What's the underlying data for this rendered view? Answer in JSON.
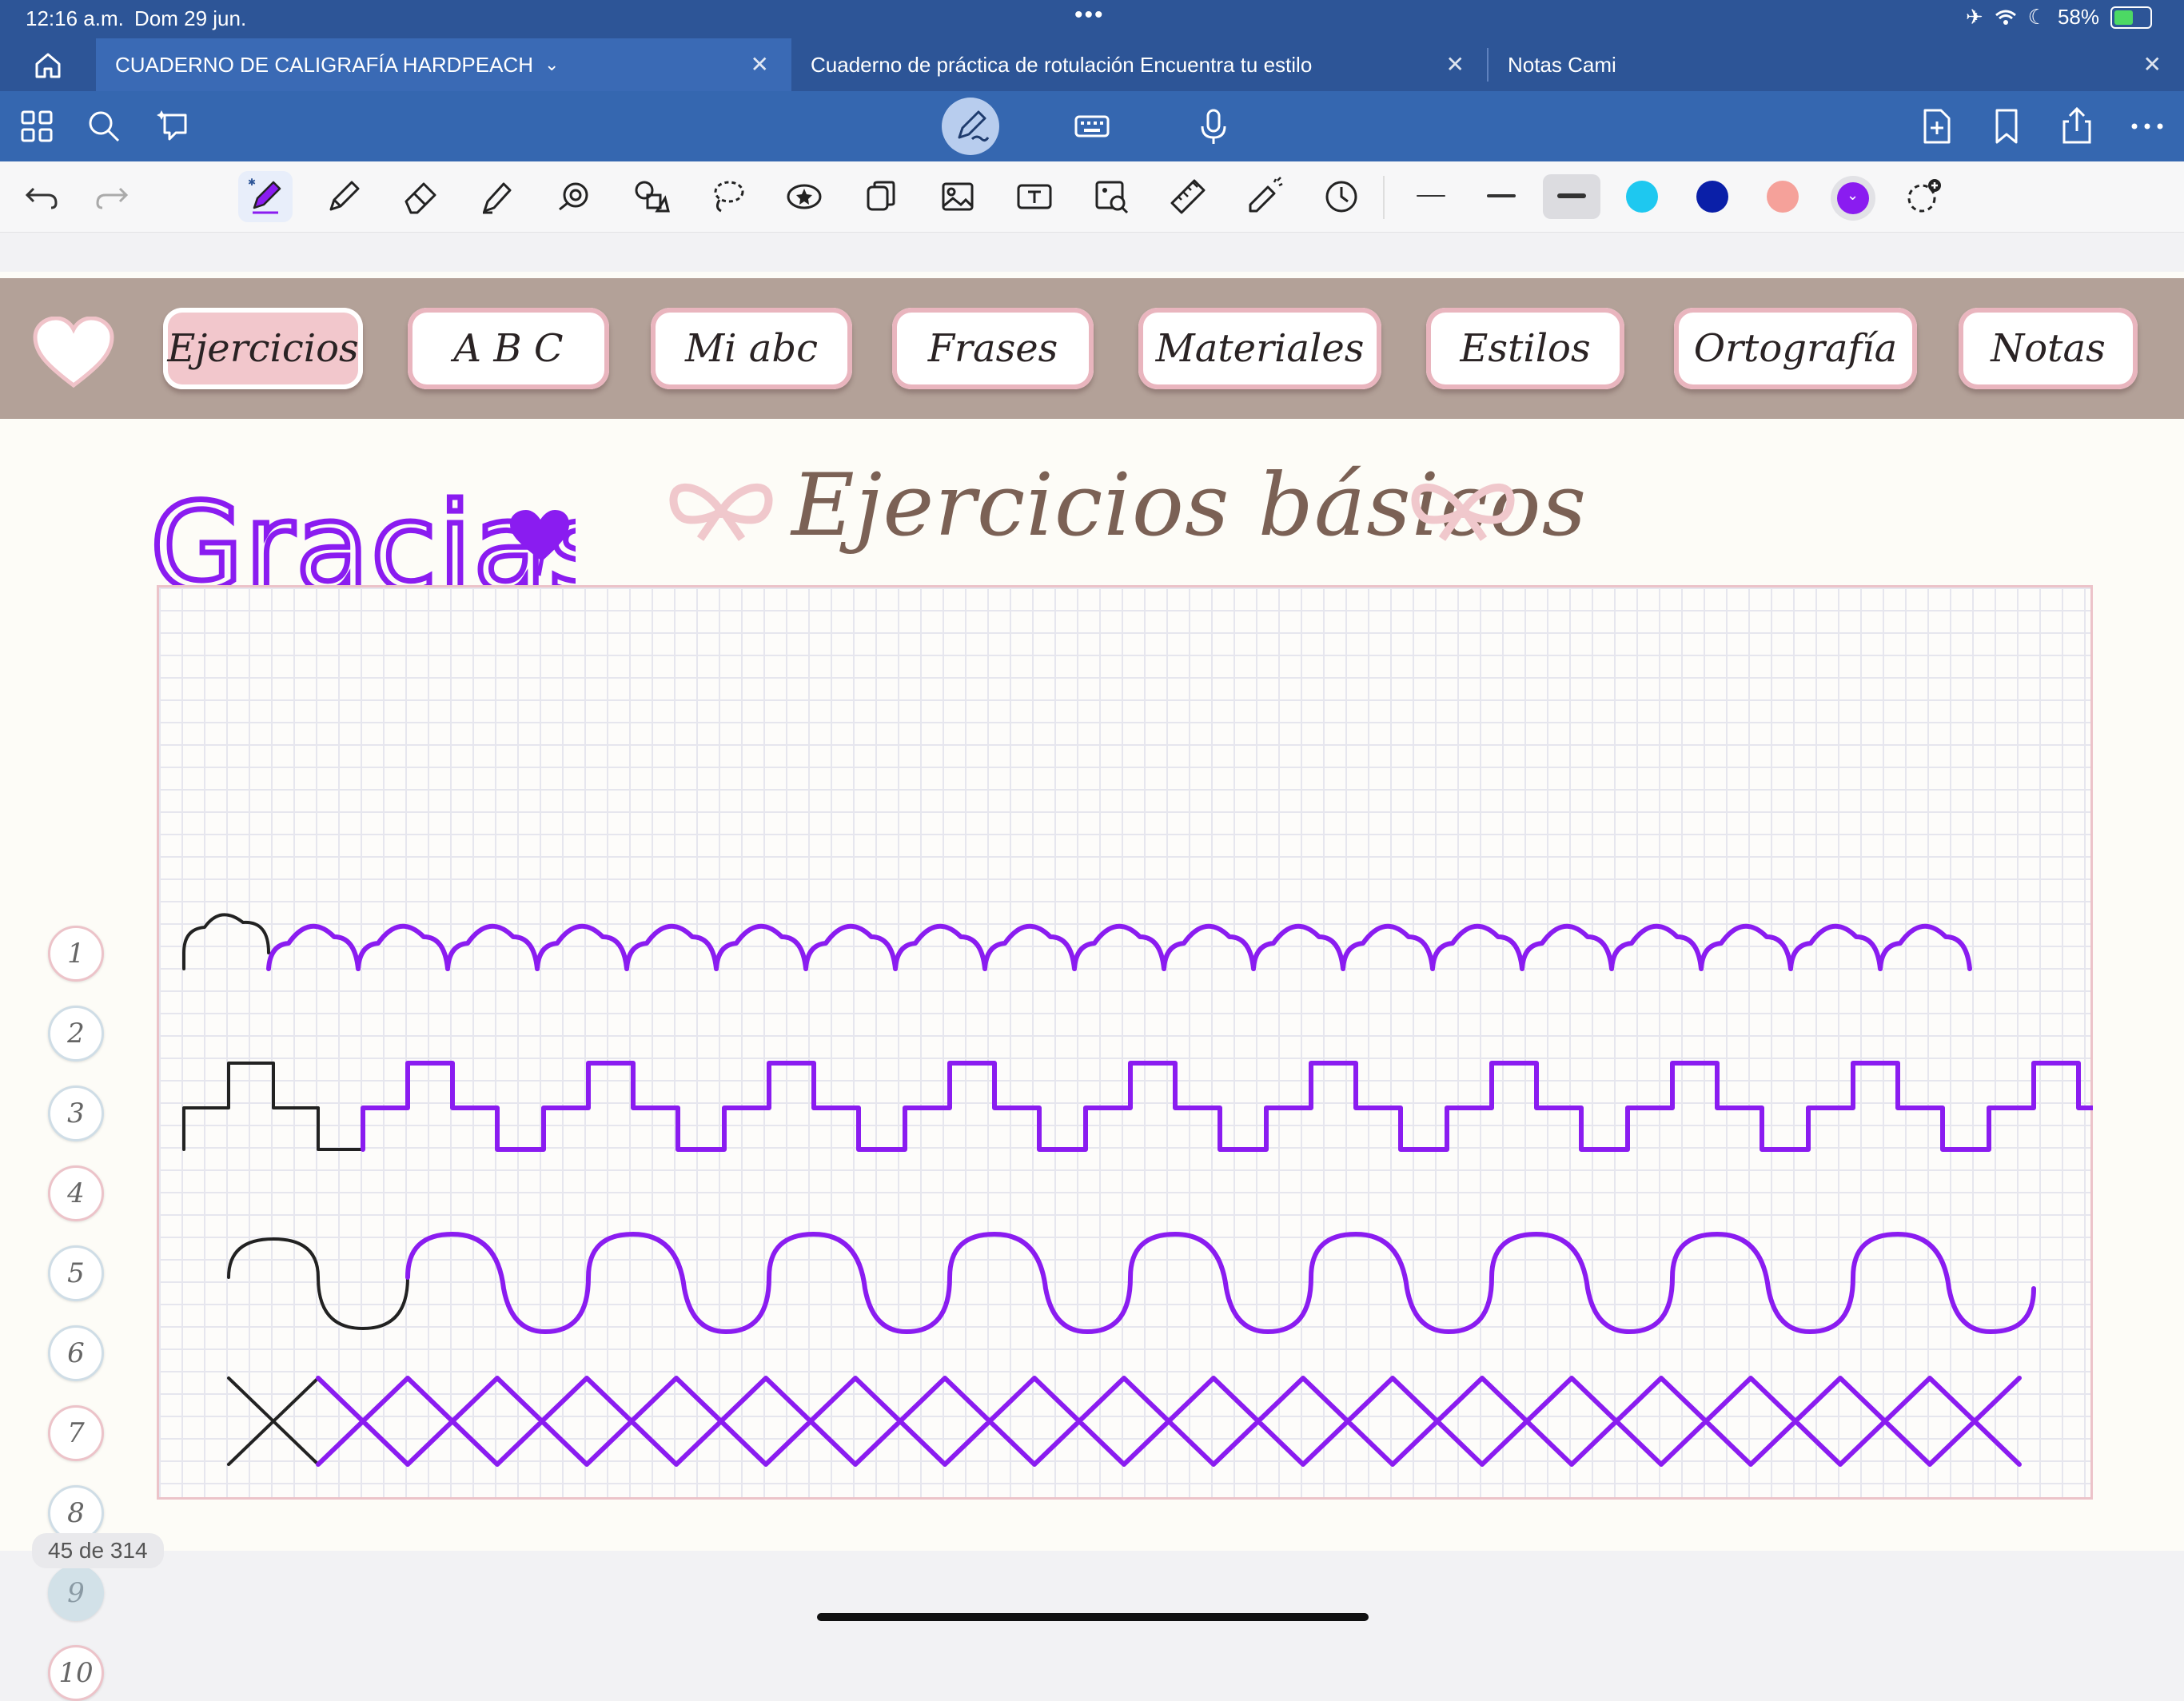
{
  "status_bar": {
    "time": "12:16 a.m.",
    "date": "Dom 29 jun.",
    "battery": "58%",
    "battery_level": 0.58
  },
  "tabs": [
    {
      "label": "CUADERNO DE CALIGRAFÍA HARDPEACH",
      "active": true
    },
    {
      "label": "Cuaderno de práctica de rotulación Encuentra tu estilo",
      "active": false
    },
    {
      "label": "Notas Cami",
      "active": false
    }
  ],
  "toolbar": {
    "colors": [
      "#1ec8f0",
      "#0a1fa8",
      "#f5a19a",
      "#8a1cf0"
    ],
    "selected_color": "#8a1cf0",
    "selected_stroke": "thick"
  },
  "notebook": {
    "section_tabs": [
      "Ejercicios",
      "A B C",
      "Mi abc",
      "Frases",
      "Materiales",
      "Estilos",
      "Ortografía",
      "Notas"
    ],
    "active_section": "Ejercicios",
    "handwritten_note": "Gracias",
    "title": "Ejercicios básicos",
    "row_numbers": [
      "1",
      "2",
      "3",
      "4",
      "5",
      "6",
      "7",
      "8",
      "9",
      "10"
    ],
    "ink_color": "#8a1cf0",
    "guide_color": "#222222"
  },
  "page_indicator": "45 de 314"
}
